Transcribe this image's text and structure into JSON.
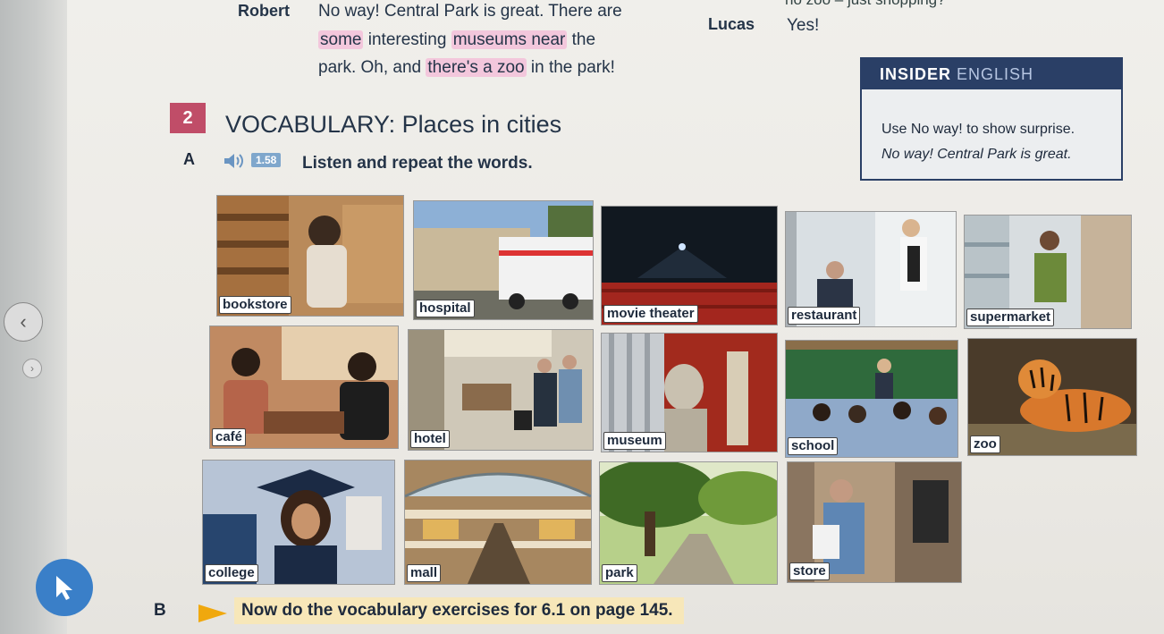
{
  "top_cut_text": "no zoo – just shopping?",
  "dialogue": {
    "robert_name": "Robert",
    "robert_line1": "No way! Central Park is great. There are",
    "robert_line2a": "some",
    "robert_line2b": " interesting ",
    "robert_line2c": "museums near",
    "robert_line2d": " the",
    "robert_line3a": "park. Oh, and ",
    "robert_line3b": "there's a zoo",
    "robert_line3c": " in the park!",
    "lucas_name": "Lucas",
    "lucas_line": "Yes!"
  },
  "insider": {
    "title_bold": "INSIDER",
    "title_light": "ENGLISH",
    "line1": "Use No way! to show surprise.",
    "line2": "No way! Central Park is great."
  },
  "section": {
    "number": "2",
    "title": "VOCABULARY: Places in cities",
    "part_a_label": "A",
    "track": "1.58",
    "instruction": "Listen and repeat the words.",
    "part_b_label": "B",
    "part_b_text": "Now do the vocabulary exercises for 6.1 on page 145."
  },
  "vocabulary": [
    "bookstore",
    "hospital",
    "movie theater",
    "restaurant",
    "supermarket",
    "café",
    "hotel",
    "museum",
    "school",
    "zoo",
    "college",
    "mall",
    "park",
    "store"
  ],
  "nav": {
    "prev_glyph": "‹",
    "next_glyph": "›"
  },
  "colors": {
    "section_number": "#c04d68",
    "insider_bar": "#2a3f66",
    "highlight": "#f3c7dc",
    "arrow": "#f0a80e",
    "cursor_button": "#3a7fc8"
  }
}
